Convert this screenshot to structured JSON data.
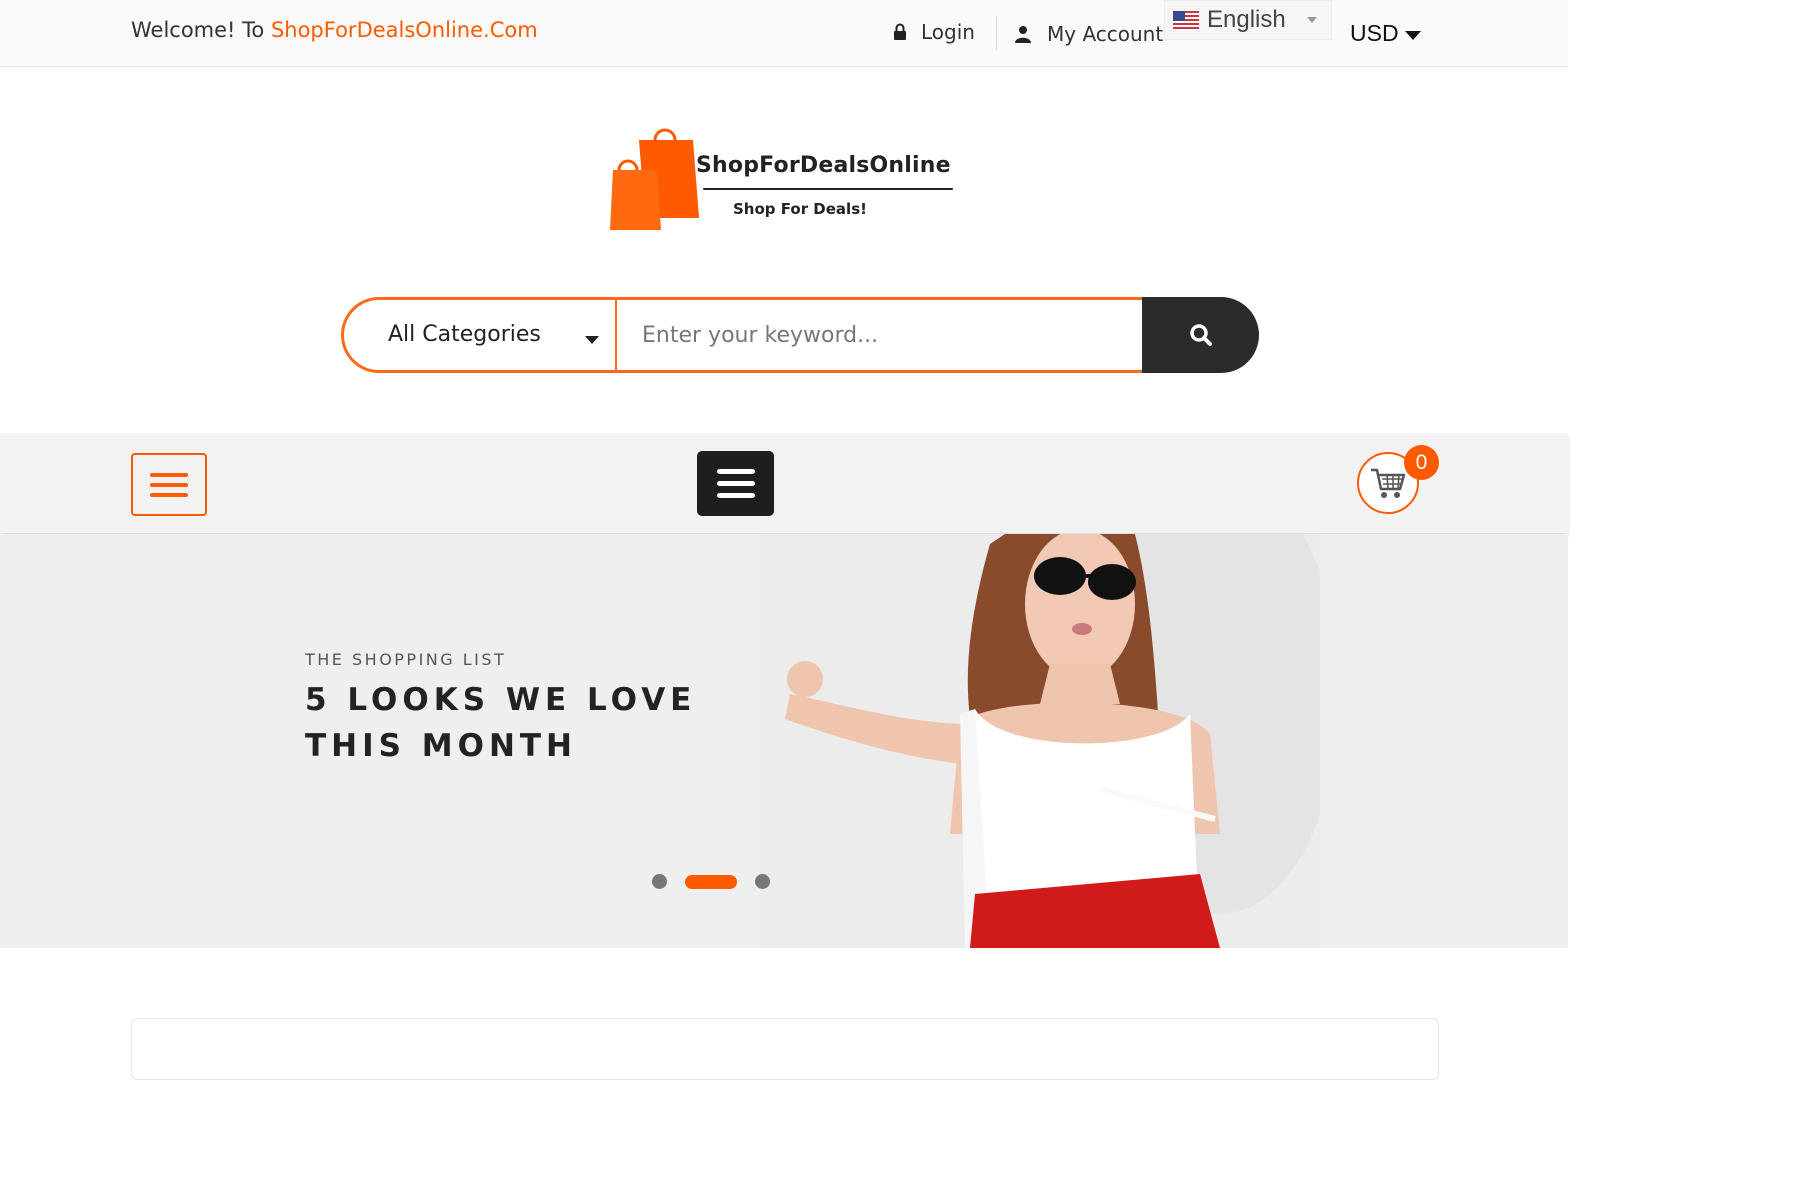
{
  "topbar": {
    "welcome_prefix": "Welcome! To ",
    "welcome_brand": "ShopForDealsOnline.Com",
    "login": "Login",
    "my_account": "My Account",
    "language": "English",
    "currency": "USD"
  },
  "logo": {
    "title": "ShopForDealsOnline",
    "tagline": "Shop For Deals!"
  },
  "search": {
    "category": "All Categories",
    "placeholder": "Enter your keyword..."
  },
  "nav": {
    "cart_count": "0"
  },
  "hero": {
    "subtitle": "THE SHOPPING LIST",
    "title": "5 LOOKS WE LOVE THIS MONTH",
    "active_slide": 2,
    "slide_count": 3
  },
  "colors": {
    "accent": "#ff5a00",
    "dark": "#2b2b2b"
  }
}
